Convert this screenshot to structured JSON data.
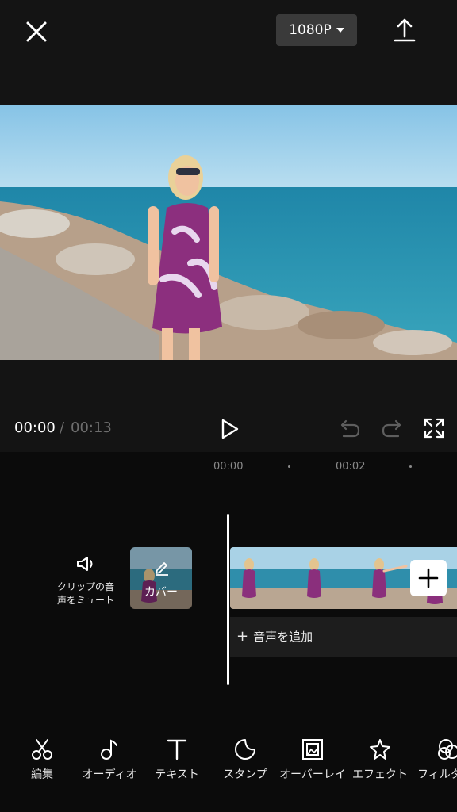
{
  "header": {
    "resolution_label": "1080P",
    "close_icon": "close-icon",
    "export_icon": "upload-icon"
  },
  "player": {
    "current_time": "00:00",
    "separator": "/",
    "total_time": "00:13",
    "play_icon": "play-icon",
    "undo_icon": "undo-icon",
    "redo_icon": "redo-icon",
    "fullscreen_icon": "fullscreen-icon"
  },
  "timeline": {
    "ticks": [
      "00:00",
      "00:02"
    ],
    "mute_label_line1": "クリップの音",
    "mute_label_line2": "声をミュート",
    "cover_label": "カバー",
    "add_audio_label": "音声を追加",
    "add_audio_plus": "+"
  },
  "toolbar": {
    "items": [
      {
        "label": "編集",
        "icon": "scissors-icon"
      },
      {
        "label": "オーディオ",
        "icon": "music-note-icon"
      },
      {
        "label": "テキスト",
        "icon": "text-icon"
      },
      {
        "label": "スタンプ",
        "icon": "sticker-icon"
      },
      {
        "label": "オーバーレイ",
        "icon": "overlay-icon"
      },
      {
        "label": "エフェクト",
        "icon": "effect-star-icon"
      },
      {
        "label": "フィルター",
        "icon": "filter-icon"
      }
    ]
  },
  "colors": {
    "background": "#0b0b0b",
    "panel": "#141414",
    "button_gray": "#3a3a3a",
    "muted_text": "#6d6d6d"
  }
}
